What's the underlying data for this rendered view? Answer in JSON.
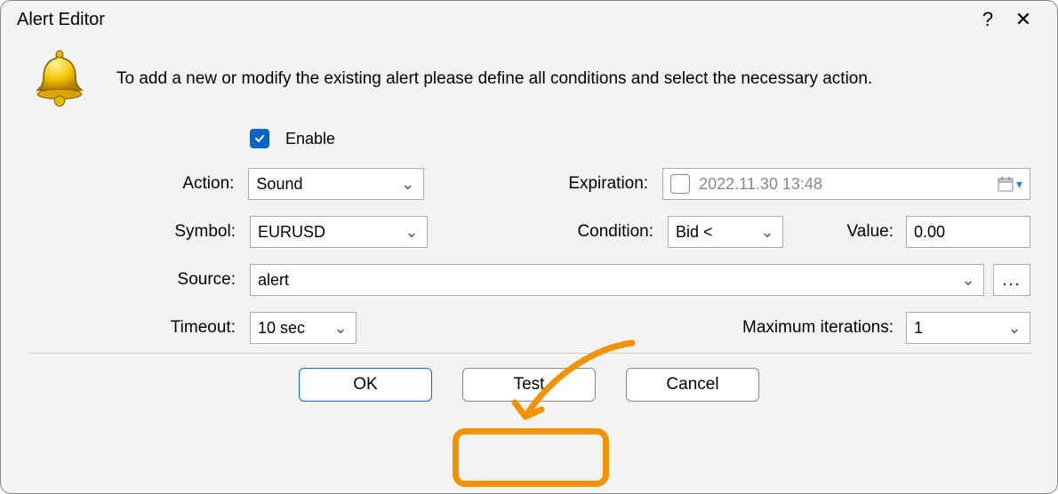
{
  "window": {
    "title": "Alert Editor",
    "help_tooltip": "?",
    "close_tooltip": "✕"
  },
  "intro": "To add a new or modify the existing alert please define all conditions and select the necessary action.",
  "form": {
    "enable_label": "Enable",
    "enable_checked": true,
    "action_label": "Action:",
    "action_value": "Sound",
    "symbol_label": "Symbol:",
    "symbol_value": "EURUSD",
    "source_label": "Source:",
    "source_value": "alert",
    "browse_label": "...",
    "timeout_label": "Timeout:",
    "timeout_value": "10 sec",
    "expiration_label": "Expiration:",
    "expiration_value": "2022.11.30 13:48",
    "expiration_checked": false,
    "condition_label": "Condition:",
    "condition_value": "Bid <",
    "value_label": "Value:",
    "value_value": "0.00",
    "max_iter_label": "Maximum iterations:",
    "max_iter_value": "1"
  },
  "buttons": {
    "ok": "OK",
    "test": "Test",
    "cancel": "Cancel"
  }
}
